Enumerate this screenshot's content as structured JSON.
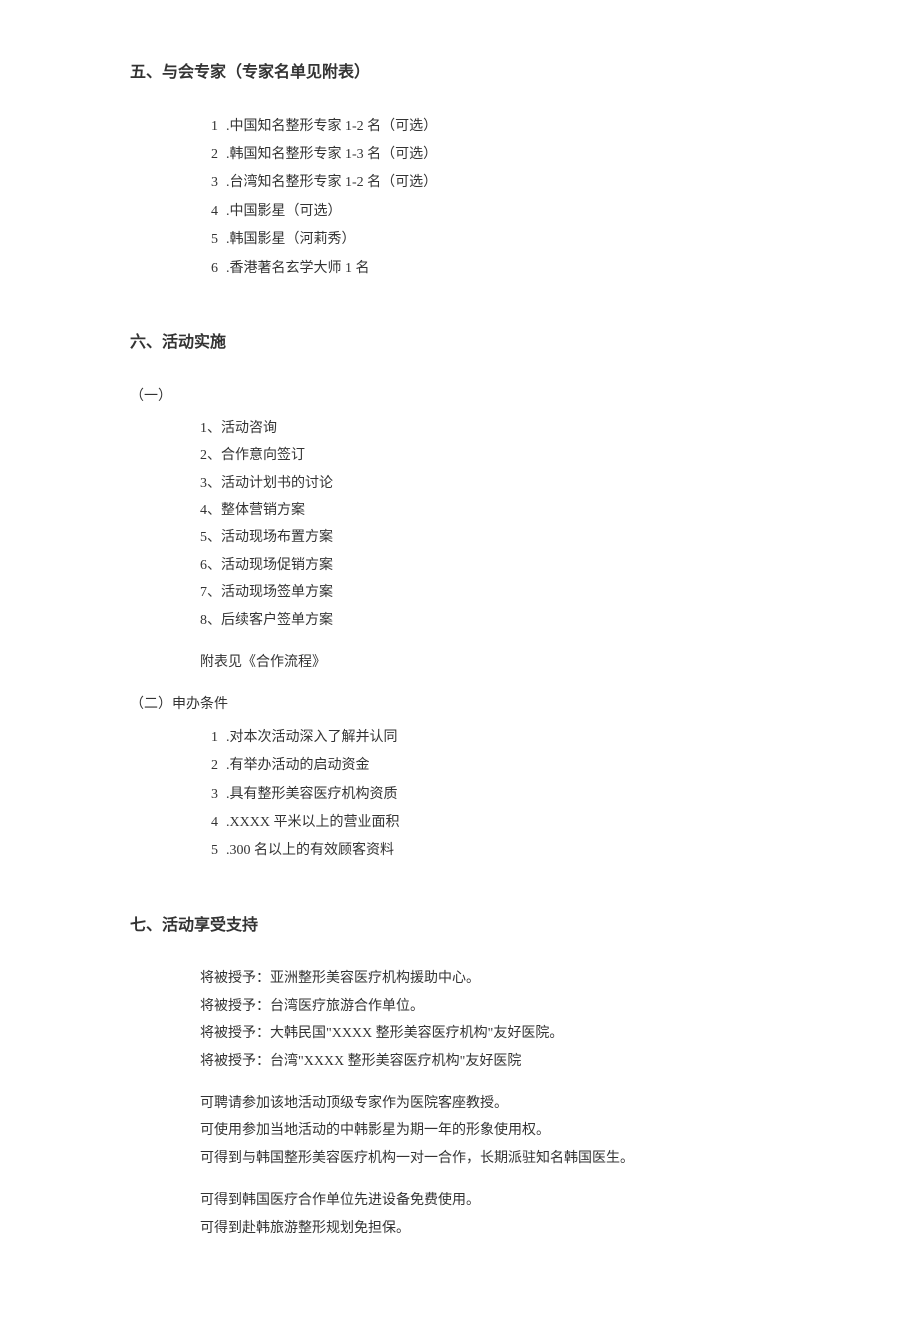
{
  "section5": {
    "heading": "五、与会专家（专家名单见附表）",
    "items": [
      {
        "num": "1",
        "text": ".中国知名整形专家 1-2 名（可选）"
      },
      {
        "num": "2",
        "text": ".韩国知名整形专家 1-3 名（可选）"
      },
      {
        "num": "3",
        "text": ".台湾知名整形专家 1-2 名（可选）"
      },
      {
        "num": "4",
        "text": ".中国影星（可选）"
      },
      {
        "num": "5",
        "text": ".韩国影星（河莉秀）"
      },
      {
        "num": "6",
        "text": ".香港著名玄学大师 1 名"
      }
    ]
  },
  "section6": {
    "heading": "六、活动实施",
    "sub1": {
      "label": "（一）",
      "items": [
        "1、活动咨询",
        "2、合作意向签订",
        "3、活动计划书的讨论",
        "4、整体营销方案",
        "5、活动现场布置方案",
        "6、活动现场促销方案",
        "7、活动现场签单方案",
        "8、后续客户签单方案"
      ],
      "note": "附表见《合作流程》"
    },
    "sub2": {
      "label": "（二）申办条件",
      "items": [
        {
          "num": "1",
          "text": ".对本次活动深入了解并认同"
        },
        {
          "num": "2",
          "text": ".有举办活动的启动资金"
        },
        {
          "num": "3",
          "text": ".具有整形美容医疗机构资质"
        },
        {
          "num": "4",
          "text": ".XXXX 平米以上的营业面积"
        },
        {
          "num": "5",
          "text": ".300 名以上的有效顾客资料"
        }
      ]
    }
  },
  "section7": {
    "heading": "七、活动享受支持",
    "block1": [
      "将被授予：亚洲整形美容医疗机构援助中心。",
      "将被授予：台湾医疗旅游合作单位。",
      "将被授予：大韩民国\"XXXX 整形美容医疗机构\"友好医院。",
      "将被授予：台湾\"XXXX 整形美容医疗机构\"友好医院"
    ],
    "block2": [
      "可聘请参加该地活动顶级专家作为医院客座教授。",
      "可使用参加当地活动的中韩影星为期一年的形象使用权。",
      "可得到与韩国整形美容医疗机构一对一合作，长期派驻知名韩国医生。"
    ],
    "block3": [
      "可得到韩国医疗合作单位先进设备免费使用。",
      "可得到赴韩旅游整形规划免担保。"
    ]
  }
}
